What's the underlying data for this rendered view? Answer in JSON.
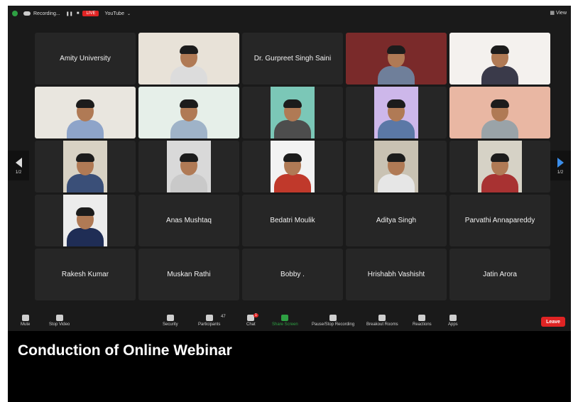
{
  "topbar": {
    "recording": "Recording...",
    "live": "LIVE",
    "youtube": "YouTube",
    "view": "View"
  },
  "nav": {
    "page": "1/2"
  },
  "tiles": [
    {
      "name": "Amity University",
      "video": false
    },
    {
      "name": "",
      "video": true,
      "bg": "#e8e2d8",
      "shirt": "#dcdcdc"
    },
    {
      "name": "Dr. Gurpreet Singh Saini",
      "video": false
    },
    {
      "name": "",
      "video": true,
      "bg": "#7a2a2a",
      "shirt": "#6f7f9a"
    },
    {
      "name": "",
      "video": true,
      "bg": "#f4f1ee",
      "shirt": "#3a3a4a"
    },
    {
      "name": "",
      "video": true,
      "bg": "#e9e6df",
      "shirt": "#8ea4c9"
    },
    {
      "name": "",
      "video": true,
      "bg": "#e6efe9",
      "shirt": "#9fb3c8",
      "active": true
    },
    {
      "name": "",
      "video": true,
      "bg": "#7bc7b7",
      "shirt": "#4d4d4d",
      "narrow": true
    },
    {
      "name": "",
      "video": true,
      "bg": "#cdb7ea",
      "shirt": "#5b78a6",
      "narrow": true
    },
    {
      "name": "",
      "video": true,
      "bg": "#e9b7a3",
      "shirt": "#9aa3a8"
    },
    {
      "name": "",
      "video": true,
      "bg": "#d8d2c4",
      "shirt": "#3a4f78",
      "narrow": true
    },
    {
      "name": "",
      "video": true,
      "bg": "#d9d9d9",
      "shirt": "#c9c9c9",
      "narrow": true
    },
    {
      "name": "",
      "video": true,
      "bg": "#f2f2f2",
      "shirt": "#c0392b",
      "narrow": true
    },
    {
      "name": "",
      "video": true,
      "bg": "#c9c2b3",
      "shirt": "#e6e6e6",
      "narrow": true
    },
    {
      "name": "",
      "video": true,
      "bg": "#d6d2c6",
      "shirt": "#a83232",
      "narrow": true
    },
    {
      "name": "",
      "video": true,
      "bg": "#ececec",
      "shirt": "#1f2d55",
      "narrow": true
    },
    {
      "name": "Anas Mushtaq",
      "video": false
    },
    {
      "name": "Bedatri Moulik",
      "video": false
    },
    {
      "name": "Aditya Singh",
      "video": false
    },
    {
      "name": "Parvathi Annapareddy",
      "video": false
    },
    {
      "name": "Rakesh Kumar",
      "video": false
    },
    {
      "name": "Muskan Rathi",
      "video": false
    },
    {
      "name": "Bobby .",
      "video": false
    },
    {
      "name": "Hrishabh Vashisht",
      "video": false
    },
    {
      "name": "Jatin Arora",
      "video": false
    }
  ],
  "toolbar": [
    {
      "label": "Mute",
      "icon": "microphone-icon"
    },
    {
      "label": "Stop Video",
      "icon": "video-camera-icon"
    },
    {
      "label": "Security",
      "icon": "shield-icon"
    },
    {
      "label": "Participants",
      "icon": "participants-icon",
      "count": "47"
    },
    {
      "label": "Chat",
      "icon": "chat-icon",
      "badge": "1"
    },
    {
      "label": "Share Screen",
      "icon": "share-screen-icon"
    },
    {
      "label": "Pause/Stop Recording",
      "icon": "pause-stop-icon"
    },
    {
      "label": "Breakout Rooms",
      "icon": "breakout-rooms-icon"
    },
    {
      "label": "Reactions",
      "icon": "reactions-icon"
    },
    {
      "label": "Apps",
      "icon": "apps-icon"
    }
  ],
  "leave": "Leave",
  "caption": "Conduction of Online Webinar",
  "colors": {
    "live": "#e02424",
    "share": "#2ea043",
    "leave": "#e02424",
    "active_border": "#2ea043"
  }
}
